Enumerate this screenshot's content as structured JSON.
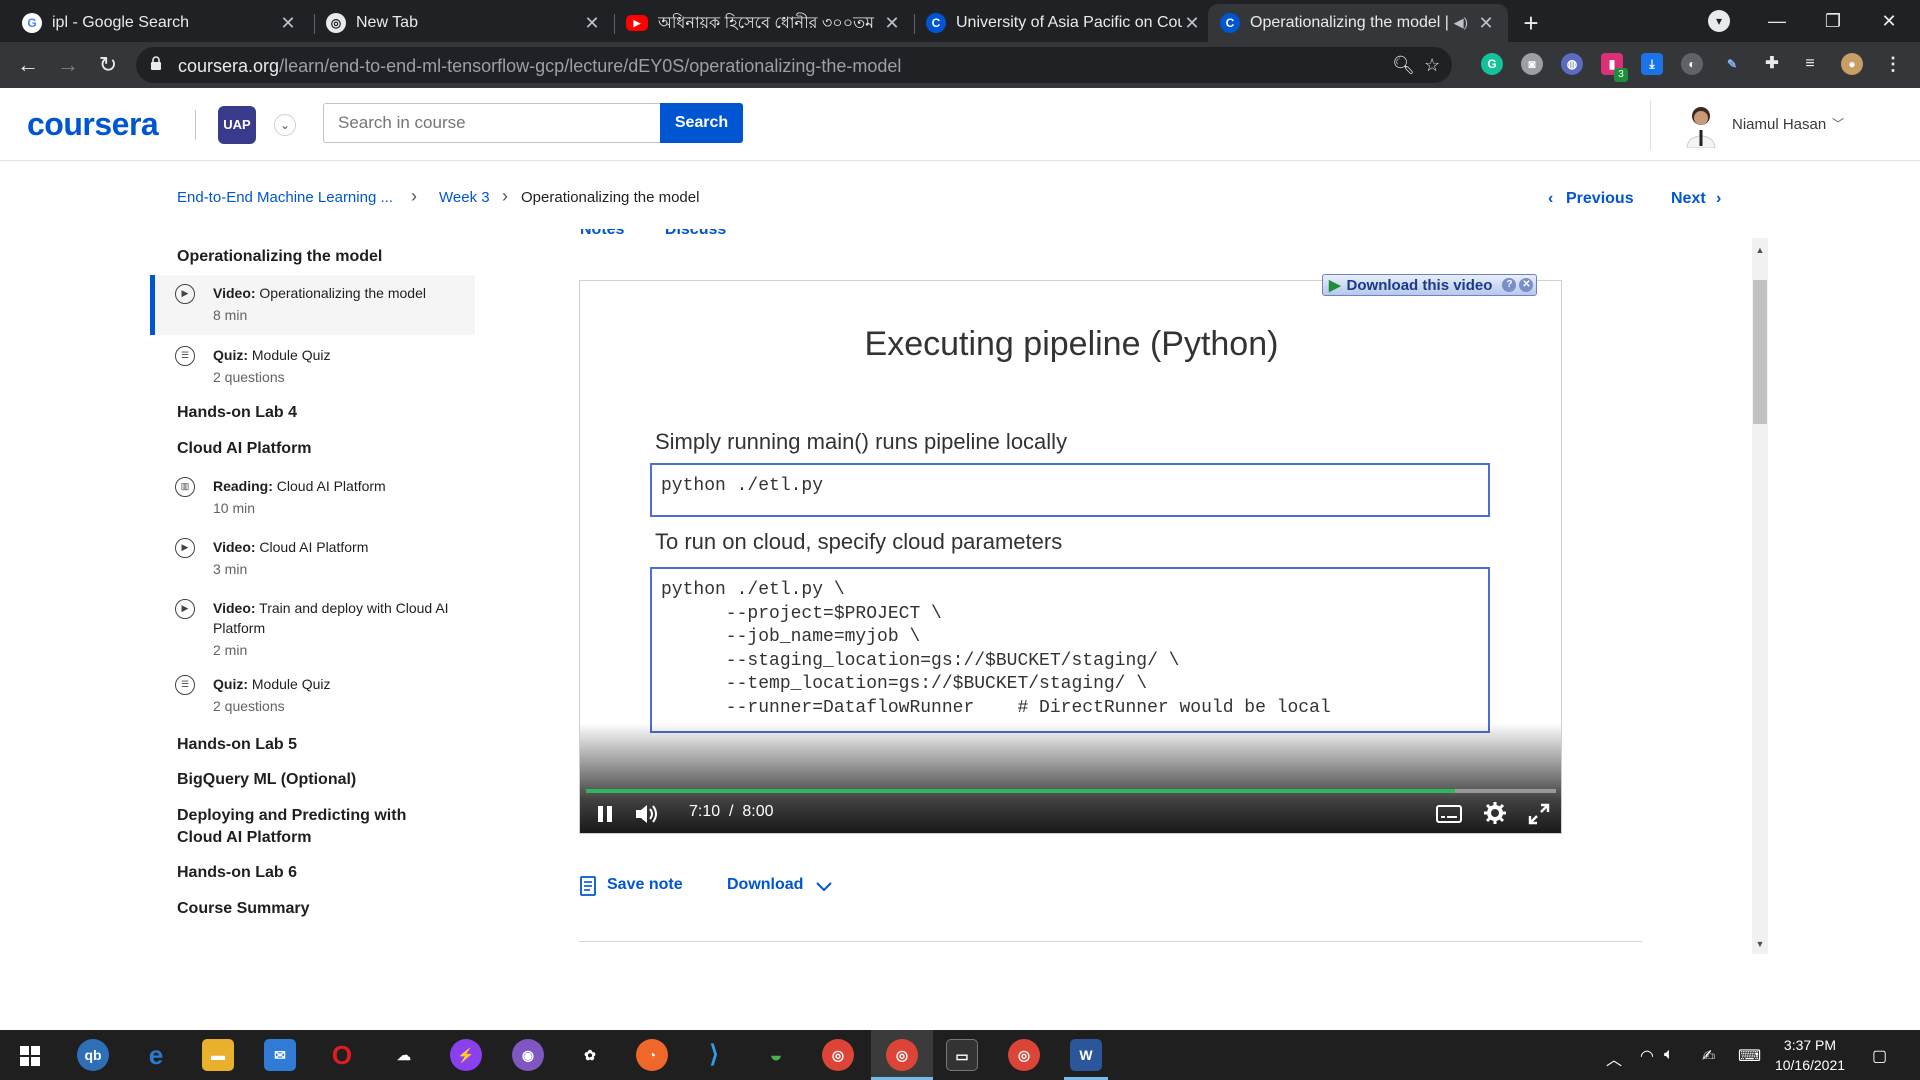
{
  "browser": {
    "tabs": [
      {
        "title": "ipl - Google Search",
        "favicon": "google-icon"
      },
      {
        "title": "New Tab",
        "favicon": "chrome-icon"
      },
      {
        "title": "অধিনায়ক হিসেবে ধোনীর ৩০০তম",
        "favicon": "youtube-icon"
      },
      {
        "title": "University of Asia Pacific on Cour",
        "favicon": "coursera-icon"
      },
      {
        "title": "Operationalizing the model |",
        "favicon": "coursera-icon"
      }
    ],
    "url_host": "coursera.org",
    "url_path": "/learn/end-to-end-ml-tensorflow-gcp/lecture/dEY0S/operationalizing-the-model",
    "extension_badge": "3"
  },
  "header": {
    "logo": "coursera",
    "search_placeholder": "Search in course",
    "search_button": "Search",
    "user_name": "Niamul Hasan"
  },
  "breadcrumb": {
    "course": "End-to-End Machine Learning ...",
    "week": "Week 3",
    "current": "Operationalizing the model"
  },
  "nav": {
    "previous": "Previous",
    "next": "Next"
  },
  "sidebar": {
    "sections": [
      {
        "title": "Operationalizing the model"
      },
      {
        "title": "Hands-on Lab 4"
      },
      {
        "title": "Cloud AI Platform"
      },
      {
        "title": "Hands-on Lab 5"
      },
      {
        "title": "BigQuery ML (Optional)"
      },
      {
        "title": "Deploying and Predicting with Cloud AI Platform"
      },
      {
        "title": "Hands-on Lab 6"
      },
      {
        "title": "Course Summary"
      }
    ],
    "items": [
      {
        "type": "Video:",
        "name": "Operationalizing the model",
        "duration": "8 min"
      },
      {
        "type": "Quiz:",
        "name": "Module Quiz",
        "duration": "2 questions"
      },
      {
        "type": "Reading:",
        "name": "Cloud AI Platform",
        "duration": "10 min"
      },
      {
        "type": "Video:",
        "name": "Cloud AI Platform",
        "duration": "3 min"
      },
      {
        "type": "Video:",
        "name": "Train and deploy with Cloud AI Platform",
        "duration": "2 min"
      },
      {
        "type": "Quiz:",
        "name": "Module Quiz",
        "duration": "2 questions"
      }
    ]
  },
  "content_tabs": {
    "notes": "Notes",
    "discuss": "Discuss"
  },
  "video": {
    "download_overlay": "Download this video",
    "slide_title": "Executing pipeline (Python)",
    "heading1": "Simply running main() runs pipeline locally",
    "code1": "python ./etl.py",
    "heading2": "To run on cloud, specify cloud parameters",
    "code2": "python ./etl.py \\\n      --project=$PROJECT \\\n      --job_name=myjob \\\n      --staging_location=gs://$BUCKET/staging/ \\\n      --temp_location=gs://$BUCKET/staging/ \\\n      --runner=DataflowRunner    # DirectRunner would be local",
    "current_time": "7:10",
    "time_separator": "/",
    "duration": "8:00",
    "progress": 0.8958
  },
  "actions": {
    "save_note": "Save note",
    "download": "Download"
  },
  "taskbar": {
    "time": "3:37 PM",
    "date": "10/16/2021"
  }
}
